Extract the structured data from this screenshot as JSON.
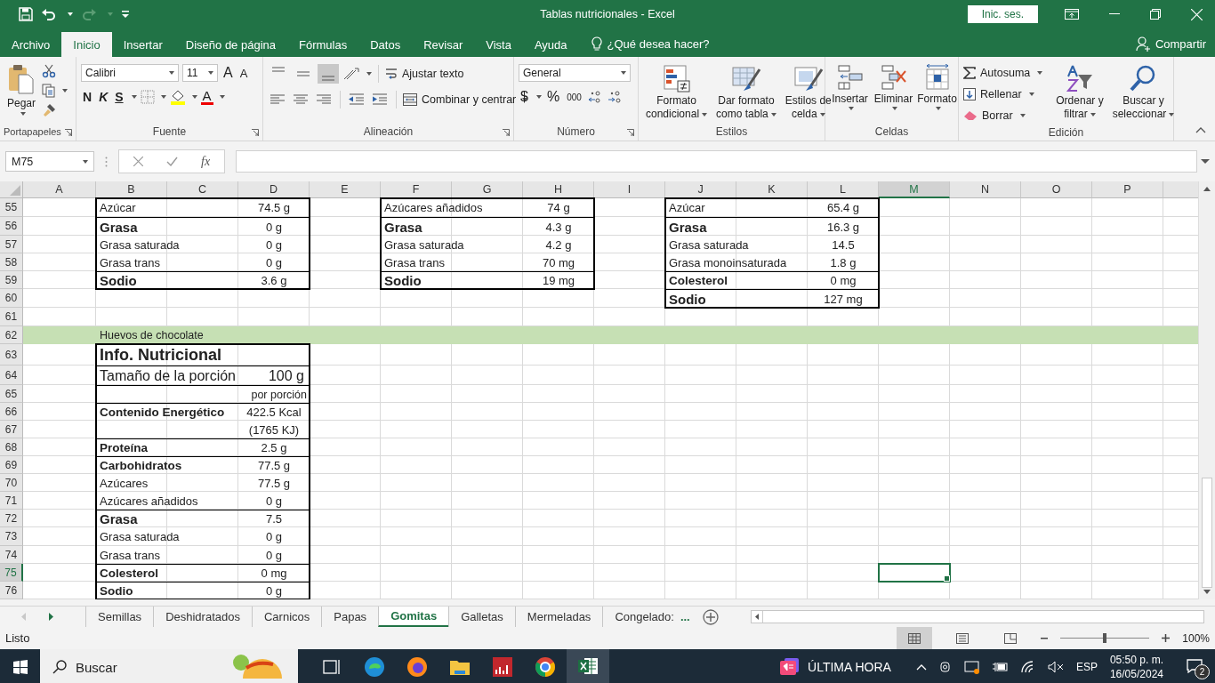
{
  "title_bar": {
    "title": "Tablas nutricionales  -  Excel",
    "sign_in": "Inic. ses."
  },
  "menu_tabs": [
    {
      "label": "Archivo",
      "selected": false
    },
    {
      "label": "Inicio",
      "selected": true
    },
    {
      "label": "Insertar",
      "selected": false
    },
    {
      "label": "Diseño de página",
      "selected": false
    },
    {
      "label": "Fórmulas",
      "selected": false
    },
    {
      "label": "Datos",
      "selected": false
    },
    {
      "label": "Revisar",
      "selected": false
    },
    {
      "label": "Vista",
      "selected": false
    },
    {
      "label": "Ayuda",
      "selected": false
    }
  ],
  "tell_me": "¿Qué desea hacer?",
  "share": "Compartir",
  "ribbon": {
    "clipboard": {
      "label": "Portapapeles",
      "paste": "Pegar"
    },
    "font": {
      "label": "Fuente",
      "font": "Calibri",
      "size": "11",
      "grow": "A",
      "shrink": "A",
      "bold": "N",
      "italic": "K",
      "underline": "S",
      "font_color": "A"
    },
    "alignment": {
      "label": "Alineación",
      "wrap": "Ajustar texto",
      "merge": "Combinar y centrar",
      "vertical": [
        {
          "kind": "top",
          "selected": false
        },
        {
          "kind": "middle",
          "selected": false
        },
        {
          "kind": "bottom",
          "selected": true
        }
      ]
    },
    "number": {
      "label": "Número",
      "format": "General",
      "currency": "$",
      "percent": "%",
      "thousands": "000"
    },
    "styles": {
      "label": "Estilos",
      "buttons": [
        {
          "lines": [
            "Formato",
            "condicional"
          ]
        },
        {
          "lines": [
            "Dar formato",
            "como tabla"
          ]
        },
        {
          "lines": [
            "Estilos de",
            "celda"
          ]
        }
      ]
    },
    "cells": {
      "label": "Celdas",
      "buttons": [
        "Insertar",
        "Eliminar",
        "Formato"
      ]
    },
    "editing": {
      "label": "Edición",
      "autosum": "Autosuma",
      "fill": "Rellenar",
      "clear": "Borrar",
      "buttons": [
        {
          "lines": [
            "Ordenar y",
            "filtrar"
          ]
        },
        {
          "lines": [
            "Buscar y",
            "seleccionar"
          ]
        }
      ]
    }
  },
  "formula_bar": {
    "name_box": "M75",
    "function": "fx"
  },
  "sheet": {
    "columns": [
      {
        "label": "A",
        "selected": false
      },
      {
        "label": "B",
        "selected": false
      },
      {
        "label": "C",
        "selected": false
      },
      {
        "label": "D",
        "selected": false
      },
      {
        "label": "E",
        "selected": false
      },
      {
        "label": "F",
        "selected": false
      },
      {
        "label": "G",
        "selected": false
      },
      {
        "label": "H",
        "selected": false
      },
      {
        "label": "I",
        "selected": false
      },
      {
        "label": "J",
        "selected": false
      },
      {
        "label": "K",
        "selected": false
      },
      {
        "label": "L",
        "selected": false
      },
      {
        "label": "M",
        "selected": true
      },
      {
        "label": "N",
        "selected": false
      },
      {
        "label": "O",
        "selected": false
      },
      {
        "label": "P",
        "selected": false
      }
    ],
    "rows": [
      {
        "label": "55",
        "selected": false
      },
      {
        "label": "56",
        "selected": false
      },
      {
        "label": "57",
        "selected": false
      },
      {
        "label": "58",
        "selected": false
      },
      {
        "label": "59",
        "selected": false
      },
      {
        "label": "60",
        "selected": false
      },
      {
        "label": "61",
        "selected": false
      },
      {
        "label": "62",
        "selected": false
      },
      {
        "label": "63",
        "selected": false
      },
      {
        "label": "64",
        "selected": false
      },
      {
        "label": "65",
        "selected": false
      },
      {
        "label": "66",
        "selected": false
      },
      {
        "label": "67",
        "selected": false
      },
      {
        "label": "68",
        "selected": false
      },
      {
        "label": "69",
        "selected": false
      },
      {
        "label": "70",
        "selected": false
      },
      {
        "label": "71",
        "selected": false
      },
      {
        "label": "72",
        "selected": false
      },
      {
        "label": "73",
        "selected": false
      },
      {
        "label": "74",
        "selected": false
      },
      {
        "label": "75",
        "selected": true
      },
      {
        "label": "76",
        "selected": false
      }
    ],
    "section_title": "Huevos de chocolate",
    "tables": [
      {
        "rows": [
          {
            "label": "Azúcar",
            "value": "74.5 g",
            "kind": "normal",
            "rule_above": false
          },
          {
            "label": "Grasa",
            "value": "0 g",
            "kind": "heading",
            "rule_above": true
          },
          {
            "label": "Grasa saturada",
            "value": "0 g",
            "kind": "normal",
            "rule_above": false
          },
          {
            "label": "Grasa trans",
            "value": "0 g",
            "kind": "normal",
            "rule_above": false
          },
          {
            "label": "Sodio",
            "value": "3.6 g",
            "kind": "heading",
            "rule_above": true
          }
        ]
      },
      {
        "rows": [
          {
            "label": "Azúcares añadidos",
            "value": "74 g",
            "kind": "normal",
            "rule_above": false
          },
          {
            "label": "Grasa",
            "value": "4.3 g",
            "kind": "heading",
            "rule_above": true
          },
          {
            "label": "Grasa saturada",
            "value": "4.2 g",
            "kind": "normal",
            "rule_above": false
          },
          {
            "label": "Grasa trans",
            "value": "70 mg",
            "kind": "normal",
            "rule_above": false
          },
          {
            "label": "Sodio",
            "value": "19 mg",
            "kind": "heading",
            "rule_above": true
          }
        ]
      },
      {
        "rows": [
          {
            "label": "Azúcar",
            "value": "65.4 g",
            "kind": "normal",
            "rule_above": false
          },
          {
            "label": "Grasa",
            "value": "16.3 g",
            "kind": "heading",
            "rule_above": true
          },
          {
            "label": "Grasa saturada",
            "value": "14.5",
            "kind": "normal",
            "rule_above": false
          },
          {
            "label": "Grasa monoinsaturada",
            "value": "1.8 g",
            "kind": "normal",
            "rule_above": false
          },
          {
            "label": "Colesterol",
            "value": "0 mg",
            "kind": "bold",
            "rule_above": true
          },
          {
            "label": "Sodio",
            "value": "127 mg",
            "kind": "heading",
            "rule_above": true
          }
        ]
      },
      {
        "rows": [
          {
            "label": "Info. Nutricional",
            "kind": "title",
            "rule_above": false
          },
          {
            "label": "Tamaño de la porción",
            "value": "100 g",
            "kind": "serving",
            "rule_above": true
          },
          {
            "value": "por porción",
            "kind": "note",
            "rule_above": true
          },
          {
            "label": "Contenido Energético",
            "value": "422.5 Kcal",
            "kind": "bold",
            "rule_above": true
          },
          {
            "value": "(1765 KJ)",
            "kind": "normal",
            "rule_above": false
          },
          {
            "label": "Proteína",
            "value": "2.5 g",
            "kind": "bold",
            "rule_above": true
          },
          {
            "label": "Carbohidratos",
            "value": "77.5 g",
            "kind": "bold",
            "rule_above": true
          },
          {
            "label": "Azúcares",
            "value": "77.5 g",
            "kind": "normal",
            "rule_above": false
          },
          {
            "label": "Azúcares añadidos",
            "value": "0 g",
            "kind": "normal",
            "rule_above": false
          },
          {
            "label": "Grasa",
            "value": "7.5",
            "kind": "heading",
            "rule_above": true
          },
          {
            "label": "Grasa saturada",
            "value": "0 g",
            "kind": "normal",
            "rule_above": false
          },
          {
            "label": "Grasa trans",
            "value": "0 g",
            "kind": "normal",
            "rule_above": false
          },
          {
            "label": "Colesterol",
            "value": "0  mg",
            "kind": "bold",
            "rule_above": true
          },
          {
            "label": "Sodio",
            "value": "0 g",
            "kind": "bold",
            "rule_above": true
          }
        ]
      }
    ]
  },
  "sheet_tabs": [
    {
      "label": "Semillas",
      "selected": false
    },
    {
      "label": "Deshidratados",
      "selected": false
    },
    {
      "label": "Carnicos",
      "selected": false
    },
    {
      "label": "Papas",
      "selected": false
    },
    {
      "label": "Gomitas",
      "selected": true
    },
    {
      "label": "Galletas",
      "selected": false
    },
    {
      "label": "Mermeladas",
      "selected": false
    },
    {
      "label": "Congelado:",
      "selected": false
    }
  ],
  "more_tabs": "...",
  "status_bar": {
    "status": "Listo",
    "views": [
      {
        "kind": "normal",
        "selected": true
      },
      {
        "kind": "layout",
        "selected": false
      },
      {
        "kind": "break",
        "selected": false
      }
    ],
    "zoom": {
      "level": 0.5,
      "reading": "100%"
    }
  },
  "taskbar": {
    "search": "Buscar",
    "apps": [
      {
        "kind": "taskview",
        "selected": false
      },
      {
        "kind": "wave",
        "selected": false
      },
      {
        "kind": "fox",
        "selected": false
      },
      {
        "kind": "folder",
        "selected": false
      },
      {
        "kind": "chart",
        "selected": false
      },
      {
        "kind": "ring",
        "selected": false
      },
      {
        "kind": "sheet",
        "selected": true
      }
    ],
    "news": "ÚLTIMA HORA",
    "language": "ESP",
    "time": "05:50 p. m.",
    "date": "16/05/2024",
    "notifications": "2"
  }
}
